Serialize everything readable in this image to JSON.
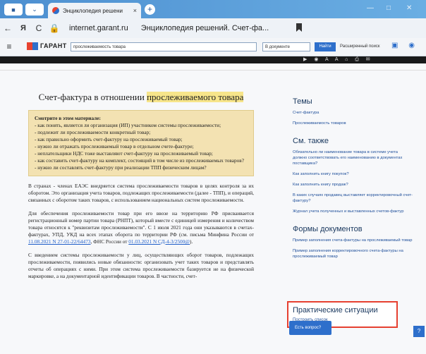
{
  "browser": {
    "tab_title": "Энциклопедия решени",
    "tab_close": "×",
    "new_tab": "+",
    "url": "internet.garant.ru",
    "page_title": "Энциклопедия решений. Счет-фа...",
    "back": "←",
    "reload": "C",
    "yandex": "Я",
    "menu": "≡",
    "win_min": "—",
    "win_max": "□",
    "win_close": "✕"
  },
  "garant": {
    "logo": "ГАРАНТ",
    "search_value": "прослеживаемость товара",
    "scope_select": "В документе",
    "find_button": "Найти",
    "extended_search": "Расширенный поиск"
  },
  "document": {
    "title_plain": "Счет-фактура в отношении ",
    "title_highlight": "прослеживаемого товара",
    "see_title": "Смотрите в этом материале:",
    "see_items": [
      "- как понять, является ли организация (ИП) участником системы прослеживаемости;",
      "- подлежит ли прослеживаемости конкретный товар;",
      "- как правильно оформить счет-фактуру на прослеживаемый товар;",
      "- нужно ли отражать прослеживаемый товар в отдельном счете-фактуре;",
      "- неплательщики НДС тоже выставляют счет-фактуру на прослеживаемый товар;",
      "- как составить счет-фактуру на комплект, состоящий в том числе из прослеживаемых товаров?",
      "- нужно ли составлять счет-фактуру при реализации ТПП физическим лицам?"
    ],
    "p1": "В странах - членах ЕАЭС внедряется система прослеживаемости товаров в целях контроля за их оборотом. Это организация учета товаров, подлежащих прослеживаемости (далее - ТПП), и операций, связанных с оборотом таких товаров, с использованием национальных систем прослеживаемости.",
    "p2a": "Для обеспечения прослеживаемости товар при его ввозе на территорию РФ присваивается регистрационный номер партии товара (РНПТ), который вместе с единицей измерения и количеством товара относятся к \"реквизитам прослеживаемости\". С 1 июля 2021 года они указываются в счетах-фактурах, УПД, УКД на всех этапах оборота по территории РФ (см. письма Минфина России от ",
    "p2_link1": "11.08.2021 N 27-01-22/64473",
    "p2b": ", ФНС России от ",
    "p2_link2": "01.03.2021 N СД-4-3/2500@",
    "p2c": ").",
    "p3": "С введением системы прослеживаемости у лиц, осуществляющих оборот товаров, подлежащих прослеживаемости, появились новые обязанности: организовать учет таких товаров и представлять отчеты об операциях с ними. При этом система прослеживаемости базируется не на физической маркировке, а на документарной идентификации товаров. В частности, счет-"
  },
  "sidebar": {
    "themes_title": "Темы",
    "themes": [
      "Счет-фактура",
      "Прослеживаемость товаров"
    ],
    "see_also_title": "См. также",
    "see_also": [
      "Обязательно ли наименование товара в системе учета должно соответствовать его наименованию в документах поставщика?",
      "Как заполнить книгу покупок?",
      "Как заполнить книгу продаж?",
      "В каких случаях продавец выставляет корректировочный счет-фактуру?",
      "Журнал учета полученных и выставленных счетов-фактур"
    ],
    "forms_title": "Формы документов",
    "forms": [
      "Пример заполнения счета-фактуры на прослеживаемый товар",
      "Пример заполнения корректировочного счета-фактуры на прослеживаемый товар"
    ],
    "situations_title": "Практические ситуации",
    "situations_link": "Построить список"
  },
  "footer": {
    "chat_button": "Есть вопрос?",
    "help_button": "?"
  }
}
